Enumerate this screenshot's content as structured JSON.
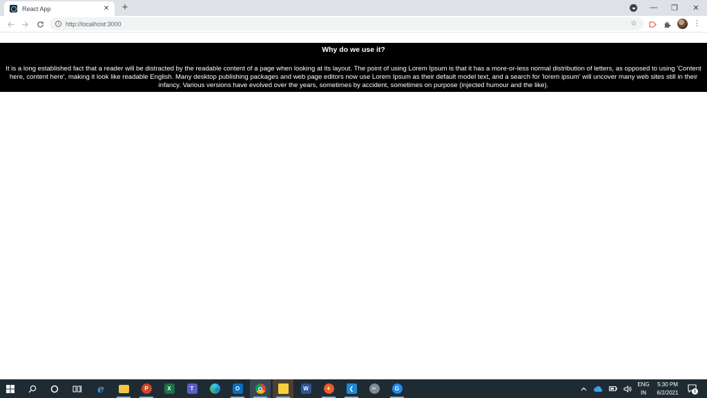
{
  "browser": {
    "tab_title": "React App",
    "tab_close": "✕",
    "new_tab": "+",
    "url": "http://localhost:3000",
    "window_minimize": "—",
    "window_restore": "❐",
    "window_close": "✕"
  },
  "page": {
    "heading": "Why do we use it?",
    "body": "It is a long established fact that a reader will be distracted by the readable content of a page when looking at its layout. The point of using Lorem Ipsum is that it has a more-or-less normal distribution of letters, as opposed to using 'Content here, content here', making it look like readable English. Many desktop publishing packages and web page editors now use Lorem Ipsum as their default model text, and a search for 'lorem ipsum' will uncover many web sites still in their infancy. Various versions have evolved over the years, sometimes by accident, sometimes on purpose (injected humour and the like)."
  },
  "taskbar": {
    "language": "ENG",
    "region": "IN",
    "time": "5:30 PM",
    "date": "6/2/2021",
    "notifications": "1"
  },
  "colors": {
    "banner_bg": "#000000",
    "banner_text": "#ffffff",
    "tabstrip_bg": "#dee1e6",
    "taskbar_bg": "#1f2b33"
  }
}
